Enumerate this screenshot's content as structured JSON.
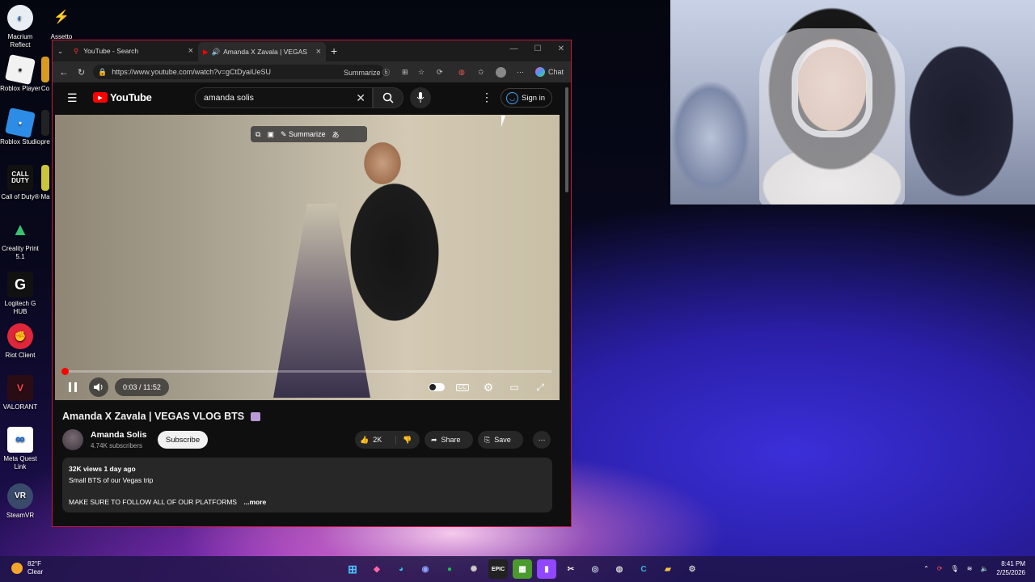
{
  "desktop": {
    "icons": [
      {
        "label": "Macrium Reflect"
      },
      {
        "label": "Assetto Corsa"
      },
      {
        "label": "Roblox Player"
      },
      {
        "label": "Co"
      },
      {
        "label": "Roblox Studio"
      },
      {
        "label": "pre"
      },
      {
        "label": "Call of Duty®"
      },
      {
        "label": "Ma"
      },
      {
        "label": "Creality Print 5.1"
      },
      {
        "label": "Logitech G HUB"
      },
      {
        "label": "Riot Client"
      },
      {
        "label": "VALORANT"
      },
      {
        "label": "Meta Quest Link"
      },
      {
        "label": "SteamVR"
      }
    ]
  },
  "browser": {
    "tabs": [
      {
        "title": "YouTube - Search"
      },
      {
        "title": "Amanda X Zavala | VEGAS VL..."
      }
    ],
    "url": "https://www.youtube.com/watch?v=gCtDyaiUeSU",
    "summarize_label": "Summarize",
    "chat_label": "Chat"
  },
  "youtube": {
    "logo_text": "YouTube",
    "search_value": "amanda solis",
    "sign_in": "Sign in",
    "overlay_summarize": "Summarize",
    "player": {
      "time": "0:03 / 11:52",
      "progress_fraction": 0.004
    },
    "video_title": "Amanda X Zavala | VEGAS VLOG BTS",
    "channel_name": "Amanda Solis",
    "subscribers": "4.74K subscribers",
    "subscribe_label": "Subscribe",
    "likes": "2K",
    "share_label": "Share",
    "save_label": "Save",
    "description": {
      "meta": "32K views  1 day ago",
      "line1": "Small BTS of our Vegas trip",
      "line2": "MAKE SURE TO FOLLOW ALL OF OUR PLATFORMS",
      "more": "...more"
    }
  },
  "taskbar": {
    "temperature": "82°F",
    "condition": "Clear",
    "time": "8:41 PM",
    "date": "2/25/2026"
  },
  "colors": {
    "accent_red": "#ff0000",
    "link_blue": "#3ea6ff",
    "window_border": "#c2183a"
  }
}
